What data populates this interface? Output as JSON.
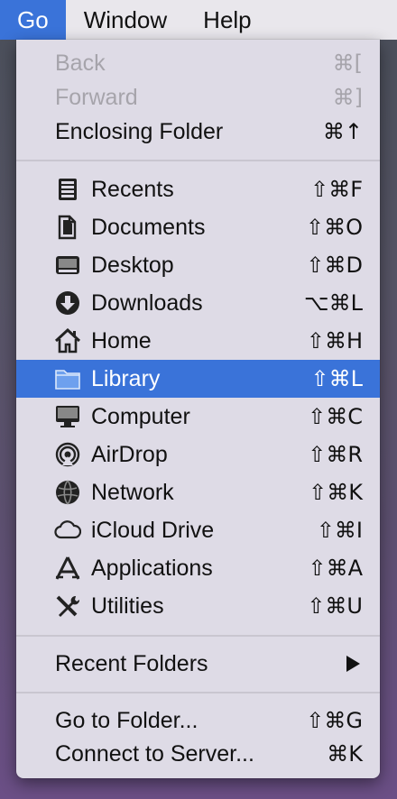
{
  "menubar": {
    "go": "Go",
    "window": "Window",
    "help": "Help"
  },
  "menu": {
    "back": {
      "label": "Back",
      "shortcut": "⌘["
    },
    "forward": {
      "label": "Forward",
      "shortcut": "⌘]"
    },
    "enclosing": {
      "label": "Enclosing Folder",
      "shortcut": "⌘↑"
    },
    "places": [
      {
        "label": "Recents",
        "shortcut": "⇧⌘F",
        "icon": "recents-icon"
      },
      {
        "label": "Documents",
        "shortcut": "⇧⌘O",
        "icon": "documents-icon"
      },
      {
        "label": "Desktop",
        "shortcut": "⇧⌘D",
        "icon": "desktop-icon"
      },
      {
        "label": "Downloads",
        "shortcut": "⌥⌘L",
        "icon": "downloads-icon"
      },
      {
        "label": "Home",
        "shortcut": "⇧⌘H",
        "icon": "home-icon"
      },
      {
        "label": "Library",
        "shortcut": "⇧⌘L",
        "icon": "folder-icon",
        "selected": true
      },
      {
        "label": "Computer",
        "shortcut": "⇧⌘C",
        "icon": "computer-icon"
      },
      {
        "label": "AirDrop",
        "shortcut": "⇧⌘R",
        "icon": "airdrop-icon"
      },
      {
        "label": "Network",
        "shortcut": "⇧⌘K",
        "icon": "network-icon"
      },
      {
        "label": "iCloud Drive",
        "shortcut": "⇧⌘I",
        "icon": "icloud-icon"
      },
      {
        "label": "Applications",
        "shortcut": "⇧⌘A",
        "icon": "applications-icon"
      },
      {
        "label": "Utilities",
        "shortcut": "⇧⌘U",
        "icon": "utilities-icon"
      }
    ],
    "recent_folders": {
      "label": "Recent Folders"
    },
    "go_to_folder": {
      "label": "Go to Folder...",
      "shortcut": "⇧⌘G"
    },
    "connect": {
      "label": "Connect to Server...",
      "shortcut": "⌘K"
    }
  },
  "colors": {
    "highlight": "#3a73d9",
    "menu_bg": "#dedbe6",
    "disabled_text": "#a6a4ab"
  }
}
